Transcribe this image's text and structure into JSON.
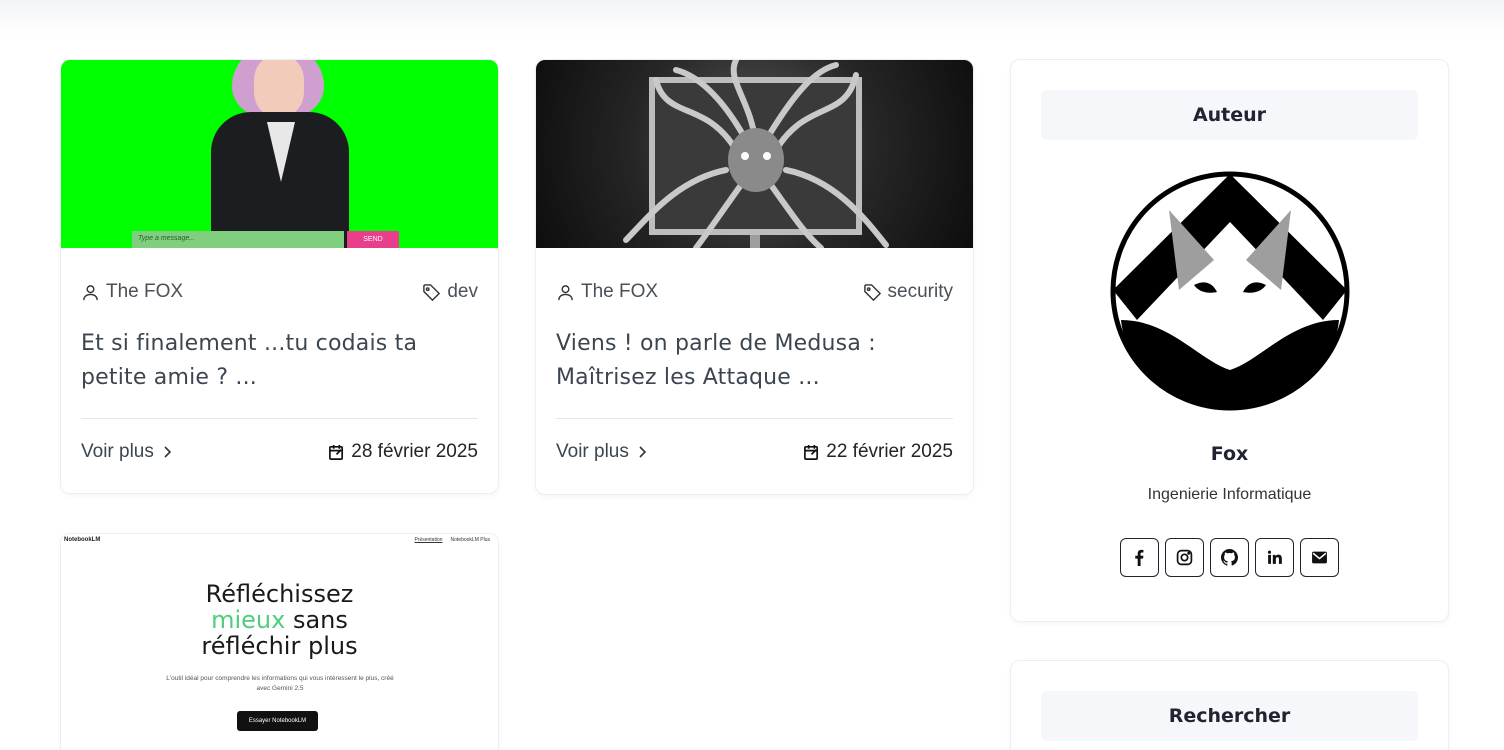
{
  "posts": [
    {
      "author": "The FOX",
      "tag": "dev",
      "title": "Et si finalement ...tu codais ta petite amie ? ...",
      "read_more": "Voir plus",
      "date": "28 février 2025",
      "image": {
        "chat_placeholder": "Type a message...",
        "send_label": "SEND"
      }
    },
    {
      "author": "The FOX",
      "tag": "security",
      "title": "Viens ! on parle de Medusa : Maîtrisez les Attaque ...",
      "read_more": "Voir plus",
      "date": "22 février 2025"
    },
    {
      "image": {
        "brand": "NotebookLM",
        "nav": [
          "Présentation",
          "NotebookLM Plus"
        ],
        "headline_1": "Réfléchissez",
        "headline_2a": "mieux",
        "headline_2b": " sans",
        "headline_3": "réfléchir plus",
        "subtitle": "L'outil idéal pour comprendre les informations qui vous intéressent le plus, créé avec Gemini 2.5",
        "cta": "Essayer NotebookLM"
      }
    }
  ],
  "sidebar": {
    "author_heading": "Auteur",
    "author_name": "Fox",
    "author_role": "Ingenierie Informatique",
    "socials": [
      "facebook-icon",
      "instagram-icon",
      "github-icon",
      "linkedin-icon",
      "mail-icon"
    ],
    "search_heading": "Rechercher"
  }
}
